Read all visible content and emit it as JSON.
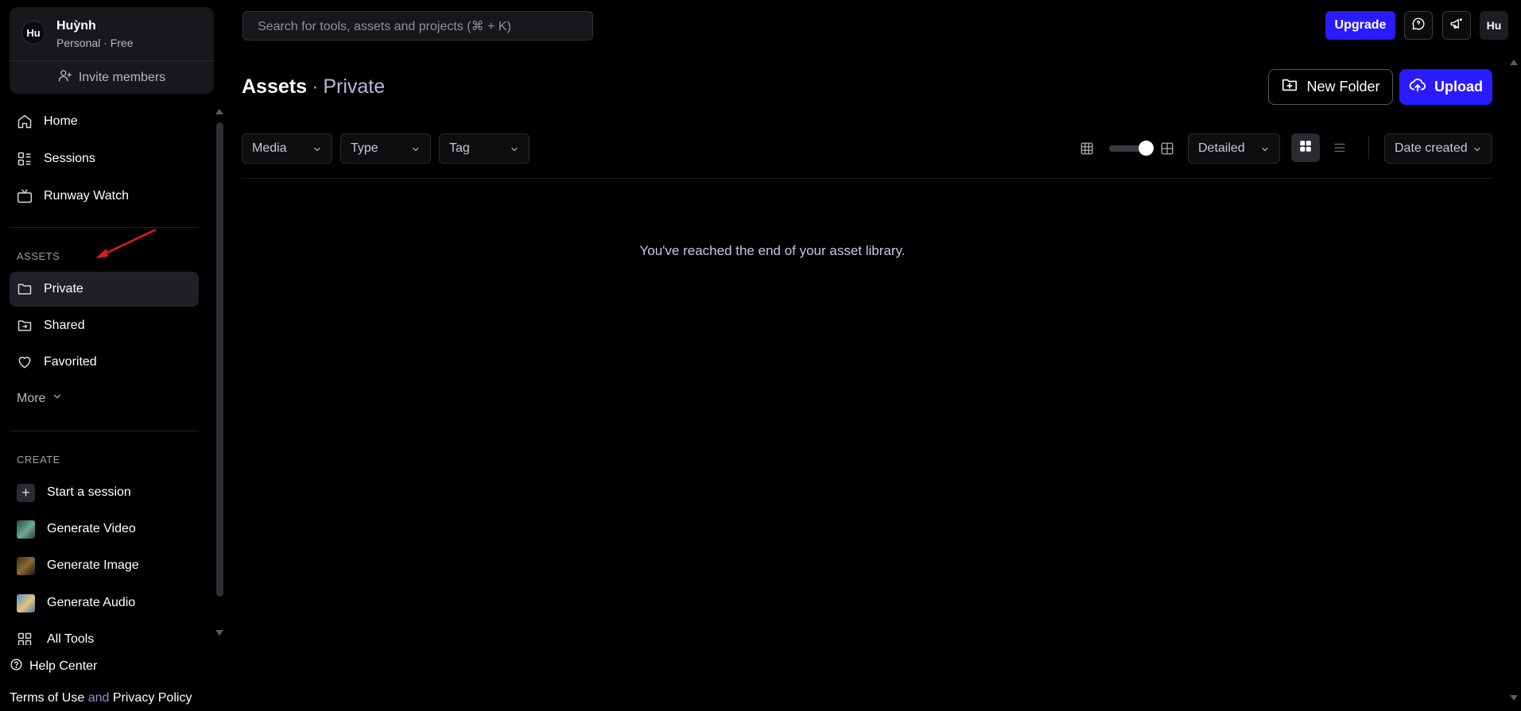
{
  "workspace": {
    "avatar_initials": "Hu",
    "name": "Huỳnh",
    "plan": "Personal · Free",
    "invite_label": "Invite members"
  },
  "nav": {
    "home": "Home",
    "sessions": "Sessions",
    "runway_watch": "Runway Watch"
  },
  "assets_section": {
    "label": "ASSETS",
    "private": "Private",
    "shared": "Shared",
    "favorited": "Favorited",
    "more": "More"
  },
  "create_section": {
    "label": "CREATE",
    "start_session": "Start a session",
    "generate_video": "Generate Video",
    "generate_image": "Generate Image",
    "generate_audio": "Generate Audio",
    "all_tools": "All Tools"
  },
  "footer": {
    "help_center": "Help Center",
    "terms": "Terms of Use",
    "and": "and",
    "privacy": "Privacy Policy"
  },
  "topbar": {
    "search_placeholder": "Search for tools, assets and projects (⌘ + K)",
    "upgrade": "Upgrade",
    "user_initials": "Hu"
  },
  "page": {
    "title": "Assets",
    "separator": "·",
    "subtitle": "Private",
    "new_folder": "New Folder",
    "upload": "Upload"
  },
  "filters": {
    "media": "Media",
    "type": "Type",
    "tag": "Tag",
    "view_mode": "Detailed",
    "sort": "Date created"
  },
  "empty_message": "You've reached the end of your asset library.",
  "colors": {
    "accent": "#2a1bff",
    "background": "#000000",
    "annotation_arrow": "#e0191b"
  }
}
